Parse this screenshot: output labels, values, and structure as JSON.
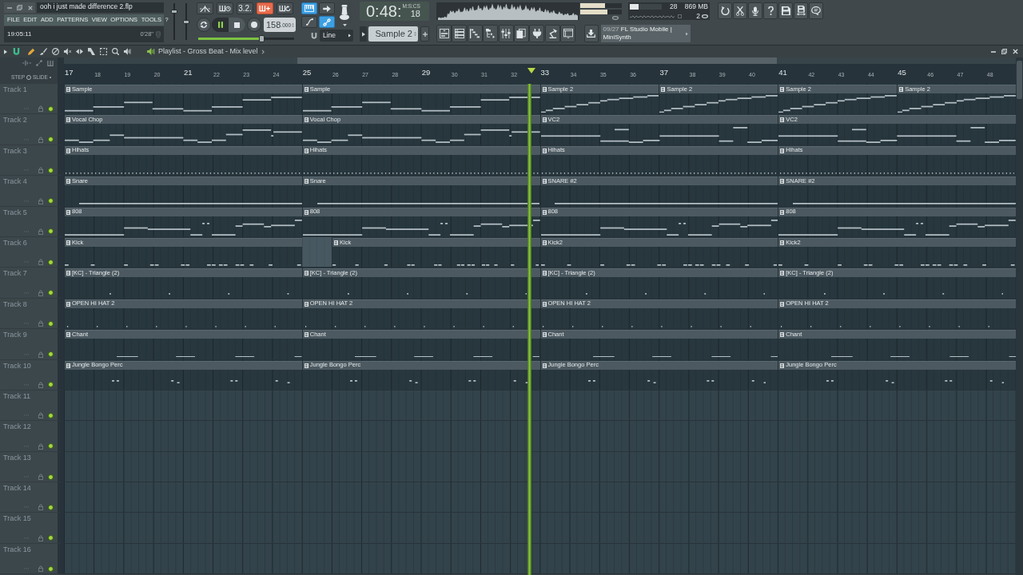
{
  "project": {
    "title": "ooh i just made difference 2.flp",
    "menu": [
      "FILE",
      "EDIT",
      "ADD",
      "PATTERNS",
      "VIEW",
      "OPTIONS",
      "TOOLS",
      "?"
    ],
    "hint_time": "19:05:11",
    "hint_length": "0'28\""
  },
  "master_sliders": [
    {
      "level": 0.8
    },
    {
      "level": 0.5
    }
  ],
  "transport": {
    "record_options": [
      {
        "kind": "wait",
        "on": false
      },
      {
        "kind": "countdown",
        "on": false
      },
      {
        "kind": "text",
        "label": "3.2.",
        "on": false
      },
      {
        "kind": "blend",
        "on": true
      },
      {
        "kind": "loop",
        "on": false
      }
    ],
    "playing": true,
    "tempo": "158",
    "tempo_decimals": ".000",
    "position": {
      "level": 0.66
    }
  },
  "toggles": [
    {
      "kind": "keyboard",
      "on": true
    },
    {
      "kind": "arrow",
      "on": false
    },
    {
      "kind": "curve",
      "on": false
    },
    {
      "kind": "link",
      "on": true
    }
  ],
  "snap": "Line",
  "time": {
    "format": "M:S:CS",
    "main": "0:48:",
    "centiseconds": "18"
  },
  "pattern": "Sample 2",
  "meters": [
    {
      "level": 0.6
    },
    {
      "level": 0.66
    }
  ],
  "performance": {
    "cpu": {
      "level": 0.28
    },
    "readouts": [
      "28",
      "869 MB",
      "2"
    ]
  },
  "news": {
    "date": "09/27",
    "headline": "FL Studio Mobile | MiniSynth"
  },
  "playlist": {
    "title": "Playlist - Gross Beat - Mix level",
    "step_label": "STEP",
    "slide_label": "SLIDE",
    "ruler": [
      "17",
      "18",
      "19",
      "20",
      "21",
      "22",
      "23",
      "24",
      "25",
      "26",
      "27",
      "28",
      "29",
      "30",
      "31",
      "32",
      "33",
      "34",
      "35",
      "36",
      "37",
      "38",
      "39",
      "40",
      "41",
      "42",
      "43",
      "44",
      "45",
      "46",
      "47",
      "48"
    ],
    "playhead": {
      "level": 0.489
    },
    "tracks": [
      {
        "name": "Track 1",
        "enabled": true,
        "clips": [
          {
            "label": "Sample",
            "kind": "long"
          },
          {
            "label": "Sample",
            "kind": "long"
          },
          {
            "label": "Sample 2",
            "kind": "short"
          },
          {
            "label": "Sample 2",
            "kind": "short"
          },
          {
            "label": "Sample 2",
            "kind": "short"
          },
          {
            "label": "Sample 2",
            "kind": "short"
          }
        ]
      },
      {
        "name": "Track 2",
        "enabled": true,
        "clips": [
          {
            "label": "Vocal Chop",
            "kind": "long"
          },
          {
            "label": "Vocal Chop",
            "kind": "long"
          },
          {
            "label": "VC2",
            "kind": "long"
          },
          {
            "label": "VC2",
            "kind": "long"
          }
        ]
      },
      {
        "name": "Track 3",
        "enabled": true,
        "clips": [
          {
            "label": "Hihats",
            "kind": "long"
          },
          {
            "label": "Hihats",
            "kind": "long"
          },
          {
            "label": "Hihats",
            "kind": "long"
          },
          {
            "label": "Hihats",
            "kind": "long"
          }
        ]
      },
      {
        "name": "Track 4",
        "enabled": true,
        "clips": [
          {
            "label": "Snare",
            "kind": "long"
          },
          {
            "label": "Snare",
            "kind": "long"
          },
          {
            "label": "SNARE #2",
            "kind": "long"
          },
          {
            "label": "SNARE #2",
            "kind": "long"
          }
        ]
      },
      {
        "name": "Track 5",
        "enabled": true,
        "clips": [
          {
            "label": "808",
            "kind": "long"
          },
          {
            "label": "808",
            "kind": "long"
          },
          {
            "label": "808",
            "kind": "long"
          },
          {
            "label": "808",
            "kind": "long"
          }
        ]
      },
      {
        "name": "Track 6",
        "enabled": true,
        "clips": [
          {
            "label": "Kick",
            "kind": "long"
          },
          {
            "kind": "gap"
          },
          {
            "label": "Kick",
            "kind": "trimmed"
          },
          {
            "label": "Kick2",
            "kind": "long"
          },
          {
            "label": "Kick2",
            "kind": "long"
          }
        ]
      },
      {
        "name": "Track 7",
        "enabled": true,
        "clips": [
          {
            "label": "[KC] - Triangle (2)",
            "kind": "long"
          },
          {
            "label": "[KC] - Triangle (2)",
            "kind": "long"
          },
          {
            "label": "[KC] - Triangle (2)",
            "kind": "long"
          },
          {
            "label": "[KC] - Triangle (2)",
            "kind": "long"
          }
        ]
      },
      {
        "name": "Track 8",
        "enabled": true,
        "clips": [
          {
            "label": "OPEN HI HAT 2",
            "kind": "long"
          },
          {
            "label": "OPEN HI HAT 2",
            "kind": "long"
          },
          {
            "label": "OPEN HI HAT 2",
            "kind": "long"
          },
          {
            "label": "OPEN HI HAT 2",
            "kind": "long"
          }
        ]
      },
      {
        "name": "Track 9",
        "enabled": true,
        "clips": [
          {
            "label": "Chant",
            "kind": "long"
          },
          {
            "label": "Chant",
            "kind": "long"
          },
          {
            "label": "Chant",
            "kind": "long"
          },
          {
            "label": "Chant",
            "kind": "long"
          }
        ]
      },
      {
        "name": "Track 10",
        "enabled": true,
        "clips": [
          {
            "label": "Jungle Bongo Perc",
            "kind": "long"
          },
          {
            "label": "Jungle Bongo Perc",
            "kind": "long"
          },
          {
            "label": "Jungle Bongo Perc",
            "kind": "long"
          },
          {
            "label": "Jungle Bongo Perc",
            "kind": "long"
          }
        ]
      },
      {
        "name": "Track 11",
        "enabled": true
      },
      {
        "name": "Track 12",
        "enabled": true
      },
      {
        "name": "Track 13",
        "enabled": true
      },
      {
        "name": "Track 14",
        "enabled": true
      },
      {
        "name": "Track 15",
        "enabled": true
      },
      {
        "name": "Track 16",
        "enabled": true
      }
    ]
  }
}
